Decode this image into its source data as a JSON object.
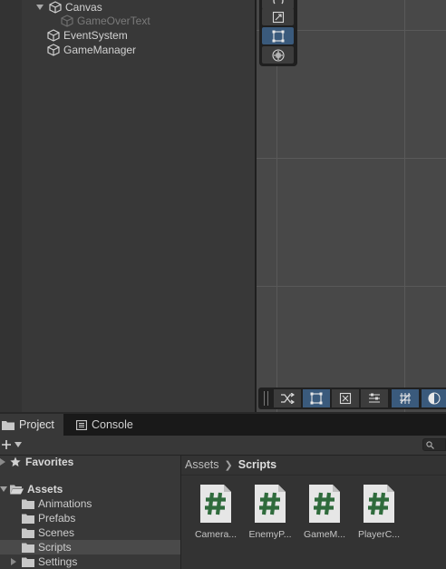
{
  "hierarchy": {
    "items": [
      {
        "label": "Canvas",
        "expanded": true
      },
      {
        "label": "GameOverText",
        "inactive": true
      },
      {
        "label": "EventSystem"
      },
      {
        "label": "GameManager"
      }
    ]
  },
  "tabs": {
    "project": "Project",
    "console": "Console"
  },
  "favorites": "Favorites",
  "tree": {
    "assets": "Assets",
    "children": [
      "Animations",
      "Prefabs",
      "Scenes",
      "Scripts",
      "Settings"
    ],
    "selected": "Scripts"
  },
  "breadcrumb": {
    "root": "Assets",
    "current": "Scripts"
  },
  "assets": [
    {
      "name": "Camera...",
      "icon": "csharp-script-icon"
    },
    {
      "name": "EnemyP...",
      "icon": "csharp-script-icon"
    },
    {
      "name": "GameM...",
      "icon": "csharp-script-icon"
    },
    {
      "name": "PlayerC...",
      "icon": "csharp-script-icon"
    }
  ],
  "colors": {
    "accent": "#3a5a7c",
    "script_hash": "#2f6b3c"
  }
}
